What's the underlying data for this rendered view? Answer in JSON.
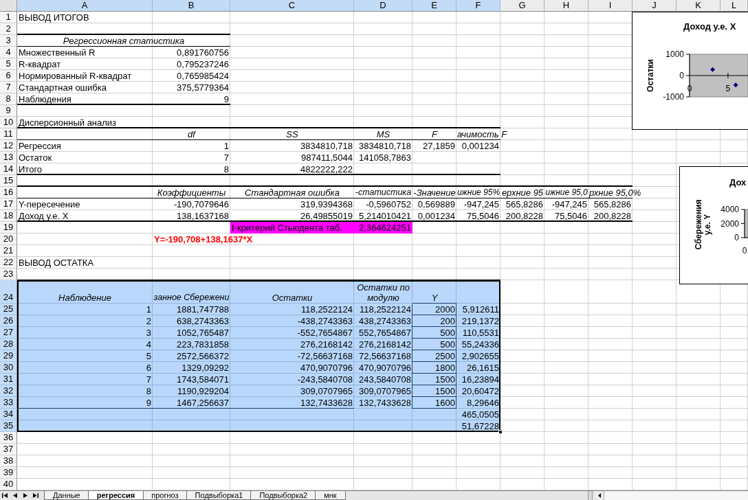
{
  "sheet": {
    "columns": [
      {
        "label": "A",
        "selected": true
      },
      {
        "label": "B",
        "selected": true
      },
      {
        "label": "C",
        "selected": true
      },
      {
        "label": "D",
        "selected": true
      },
      {
        "label": "E",
        "selected": true
      },
      {
        "label": "F",
        "selected": true
      },
      {
        "label": "G",
        "selected": false
      },
      {
        "label": "H",
        "selected": false
      },
      {
        "label": "I",
        "selected": false
      },
      {
        "label": "J",
        "selected": false
      },
      {
        "label": "K",
        "selected": false
      },
      {
        "label": "L",
        "selected": false
      }
    ],
    "rows": [
      {
        "label": "1",
        "selected": false
      },
      {
        "label": "2",
        "selected": false
      },
      {
        "label": "3",
        "selected": false
      },
      {
        "label": "4",
        "selected": false
      },
      {
        "label": "5",
        "selected": false
      },
      {
        "label": "6",
        "selected": false
      },
      {
        "label": "7",
        "selected": false
      },
      {
        "label": "8",
        "selected": false
      },
      {
        "label": "9",
        "selected": false
      },
      {
        "label": "10",
        "selected": false
      },
      {
        "label": "11",
        "selected": false
      },
      {
        "label": "12",
        "selected": false
      },
      {
        "label": "13",
        "selected": false
      },
      {
        "label": "14",
        "selected": false
      },
      {
        "label": "15",
        "selected": false
      },
      {
        "label": "16",
        "selected": false
      },
      {
        "label": "17",
        "selected": false
      },
      {
        "label": "18",
        "selected": false
      },
      {
        "label": "19",
        "selected": false
      },
      {
        "label": "20",
        "selected": false
      },
      {
        "label": "21",
        "selected": false
      },
      {
        "label": "22",
        "selected": false
      },
      {
        "label": "23",
        "selected": false
      },
      {
        "label": "24",
        "selected": true
      },
      {
        "label": "25",
        "selected": true
      },
      {
        "label": "26",
        "selected": true
      },
      {
        "label": "27",
        "selected": true
      },
      {
        "label": "28",
        "selected": true
      },
      {
        "label": "29",
        "selected": true
      },
      {
        "label": "30",
        "selected": true
      },
      {
        "label": "31",
        "selected": true
      },
      {
        "label": "32",
        "selected": true
      },
      {
        "label": "33",
        "selected": true
      },
      {
        "label": "34",
        "selected": true
      },
      {
        "label": "35",
        "selected": true
      },
      {
        "label": "36",
        "selected": false
      },
      {
        "label": "37",
        "selected": false
      },
      {
        "label": "38",
        "selected": false
      },
      {
        "label": "39",
        "selected": false
      },
      {
        "label": "40",
        "selected": false
      }
    ],
    "summary_title": "ВЫВОД ИТОГОВ",
    "regression_stats": {
      "title": "Регрессионная статистика",
      "rows": [
        {
          "label": "Множественный R",
          "value": "0,891760756"
        },
        {
          "label": "R-квадрат",
          "value": "0,795237246"
        },
        {
          "label": "Нормированный R-квадрат",
          "value": "0,765985424"
        },
        {
          "label": "Стандартная ошибка",
          "value": "375,5779364"
        },
        {
          "label": "Наблюдения",
          "value": "9"
        }
      ]
    },
    "anova": {
      "title": "Дисперсионный анализ",
      "columns": [
        "df",
        "SS",
        "MS",
        "F",
        "ачимость F"
      ],
      "rows": [
        {
          "label": "Регрессия",
          "values": [
            "1",
            "3834810,718",
            "3834810,718",
            "27,1859",
            "0,001234"
          ]
        },
        {
          "label": "Остаток",
          "values": [
            "7",
            "987411,5044",
            "141058,7863"
          ]
        },
        {
          "label": "Итого",
          "values": [
            "8",
            "4822222,222"
          ]
        }
      ]
    },
    "coefficients": {
      "columns": [
        "Коэффициенты",
        "Стандартная ошибка",
        "-статистика",
        "-Значение",
        "ижние 95%",
        "ерхние 95",
        "ижние 95,0",
        "рхние 95,0%"
      ],
      "rows": [
        {
          "label": "Y-пересечение",
          "values": [
            "-190,7079646",
            "319,9394368",
            "-0,5960752",
            "0,569889",
            "-947,245",
            "565,8286",
            "-947,245",
            "565,8286"
          ]
        },
        {
          "label": "Доход у.е. X",
          "values": [
            "138,1637168",
            "26,49855019",
            "5,214010421",
            "0,001234",
            "75,5046",
            "200,8228",
            "75,5046",
            "200,8228"
          ]
        }
      ]
    },
    "t_critical": {
      "label": "t-критерий Стьюдента таб.",
      "value": "2,364624251"
    },
    "equation": "Y=-190,708+138,1637*X",
    "residuals": {
      "title": "ВЫВОД ОСТАТКА",
      "columns": [
        "Наблюдение",
        "занное Сбережени",
        "Остатки",
        "Остатки по модулю",
        "Y"
      ],
      "rows": [
        [
          "1",
          "1881,747788",
          "118,2522124",
          "118,2522124",
          "2000",
          "5,912611"
        ],
        [
          "2",
          "638,2743363",
          "-438,2743363",
          "438,2743363",
          "200",
          "219,1372"
        ],
        [
          "3",
          "1052,765487",
          "-552,7654867",
          "552,7654867",
          "500",
          "110,5531"
        ],
        [
          "4",
          "223,7831858",
          "276,2168142",
          "276,2168142",
          "500",
          "55,24336"
        ],
        [
          "5",
          "2572,566372",
          "-72,56637168",
          "72,56637168",
          "2500",
          "2,902655"
        ],
        [
          "6",
          "1329,09292",
          "470,9070796",
          "470,9070796",
          "1800",
          "26,1615"
        ],
        [
          "7",
          "1743,584071",
          "-243,5840708",
          "243,5840708",
          "1500",
          "16,23894"
        ],
        [
          "8",
          "1190,929204",
          "309,0707965",
          "309,0707965",
          "1500",
          "20,60472"
        ],
        [
          "9",
          "1467,256637",
          "132,7433628",
          "132,7433628",
          "1600",
          "8,29646"
        ]
      ],
      "column_6_continued": [
        "465,0505",
        "51,67228"
      ]
    }
  },
  "charts": [
    {
      "chart_data": {
        "type": "scatter",
        "title": "Доход у.е. X",
        "ylabel": "Остатки",
        "x": [
          3,
          6
        ],
        "values": [
          280,
          -440
        ],
        "color": "#000080",
        "marker": "diamond",
        "xticks": [
          0,
          5
        ],
        "xlim": [
          0,
          7.6
        ],
        "yticks": [
          -1000,
          0,
          1000
        ],
        "ylim": [
          -1000,
          1000
        ]
      }
    },
    {
      "title": "Дох",
      "ylabel": "Сбережения у.е. Y",
      "y_tick_labels": [
        "4000",
        "2000",
        "0"
      ],
      "x_tick_labels": [
        "0"
      ]
    }
  ],
  "sheet_tabs": [
    {
      "label": "Данные",
      "selected": false
    },
    {
      "label": "регрессия",
      "selected": true
    },
    {
      "label": "прогноз",
      "selected": false
    },
    {
      "label": "Подвыборка1",
      "selected": false
    },
    {
      "label": "Подвыборка2",
      "selected": false
    },
    {
      "label": "мнк",
      "selected": false
    }
  ]
}
